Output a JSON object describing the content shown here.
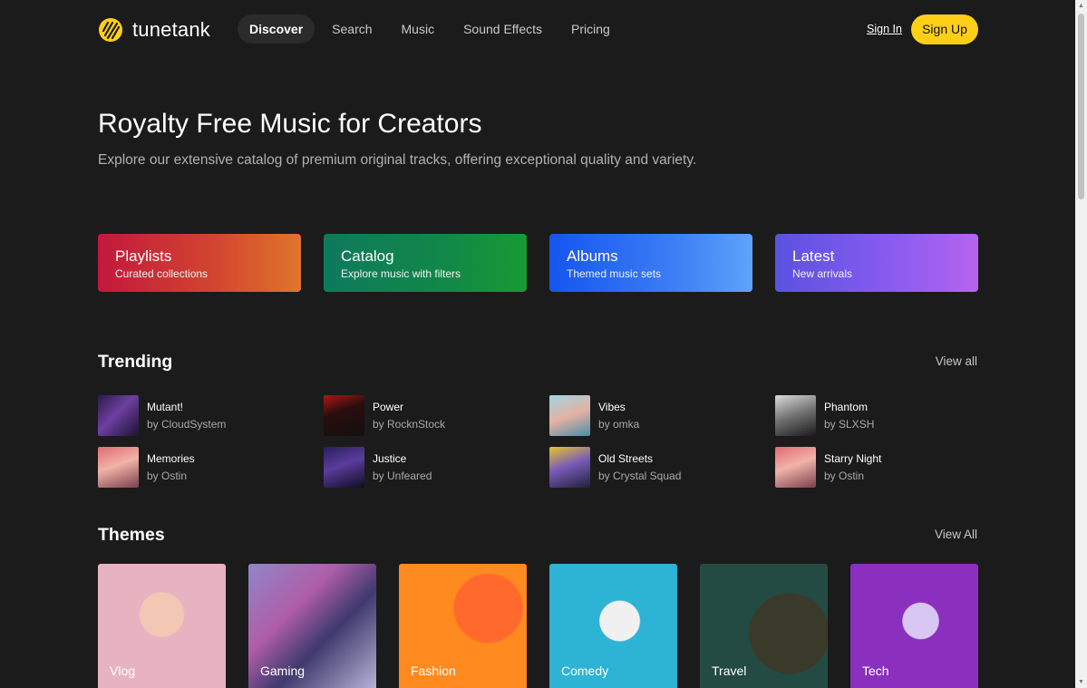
{
  "brand": {
    "name": "tunetank",
    "logo_icon": "tunetank-logo-icon",
    "accent": "#ffcf17"
  },
  "nav": {
    "items": [
      {
        "label": "Discover",
        "active": true
      },
      {
        "label": "Search",
        "active": false
      },
      {
        "label": "Music",
        "active": false
      },
      {
        "label": "Sound Effects",
        "active": false
      },
      {
        "label": "Pricing",
        "active": false
      }
    ],
    "signin_label": "Sign In",
    "signup_label": "Sign Up"
  },
  "hero": {
    "title": "Royalty Free Music for Creators",
    "subtitle": "Explore our extensive catalog of premium original tracks, offering exceptional quality and variety."
  },
  "categories": [
    {
      "title": "Playlists",
      "subtitle": "Curated collections"
    },
    {
      "title": "Catalog",
      "subtitle": "Explore music with filters"
    },
    {
      "title": "Albums",
      "subtitle": "Themed music sets"
    },
    {
      "title": "Latest",
      "subtitle": "New arrivals"
    }
  ],
  "trending": {
    "heading": "Trending",
    "view_all_label": "View all",
    "tracks": [
      {
        "title": "Mutant!",
        "artist": "by CloudSystem"
      },
      {
        "title": "Power",
        "artist": "by RocknStock"
      },
      {
        "title": "Vibes",
        "artist": "by omka"
      },
      {
        "title": "Phantom",
        "artist": "by SLXSH"
      },
      {
        "title": "Memories",
        "artist": "by Ostin"
      },
      {
        "title": "Justice",
        "artist": "by Unfeared"
      },
      {
        "title": "Old Streets",
        "artist": "by Crystal Squad"
      },
      {
        "title": "Starry Night",
        "artist": "by Ostin"
      }
    ]
  },
  "themes": {
    "heading": "Themes",
    "view_all_label": "View All",
    "items": [
      {
        "label": "Vlog"
      },
      {
        "label": "Gaming"
      },
      {
        "label": "Fashion"
      },
      {
        "label": "Comedy"
      },
      {
        "label": "Travel"
      },
      {
        "label": "Tech"
      }
    ]
  }
}
